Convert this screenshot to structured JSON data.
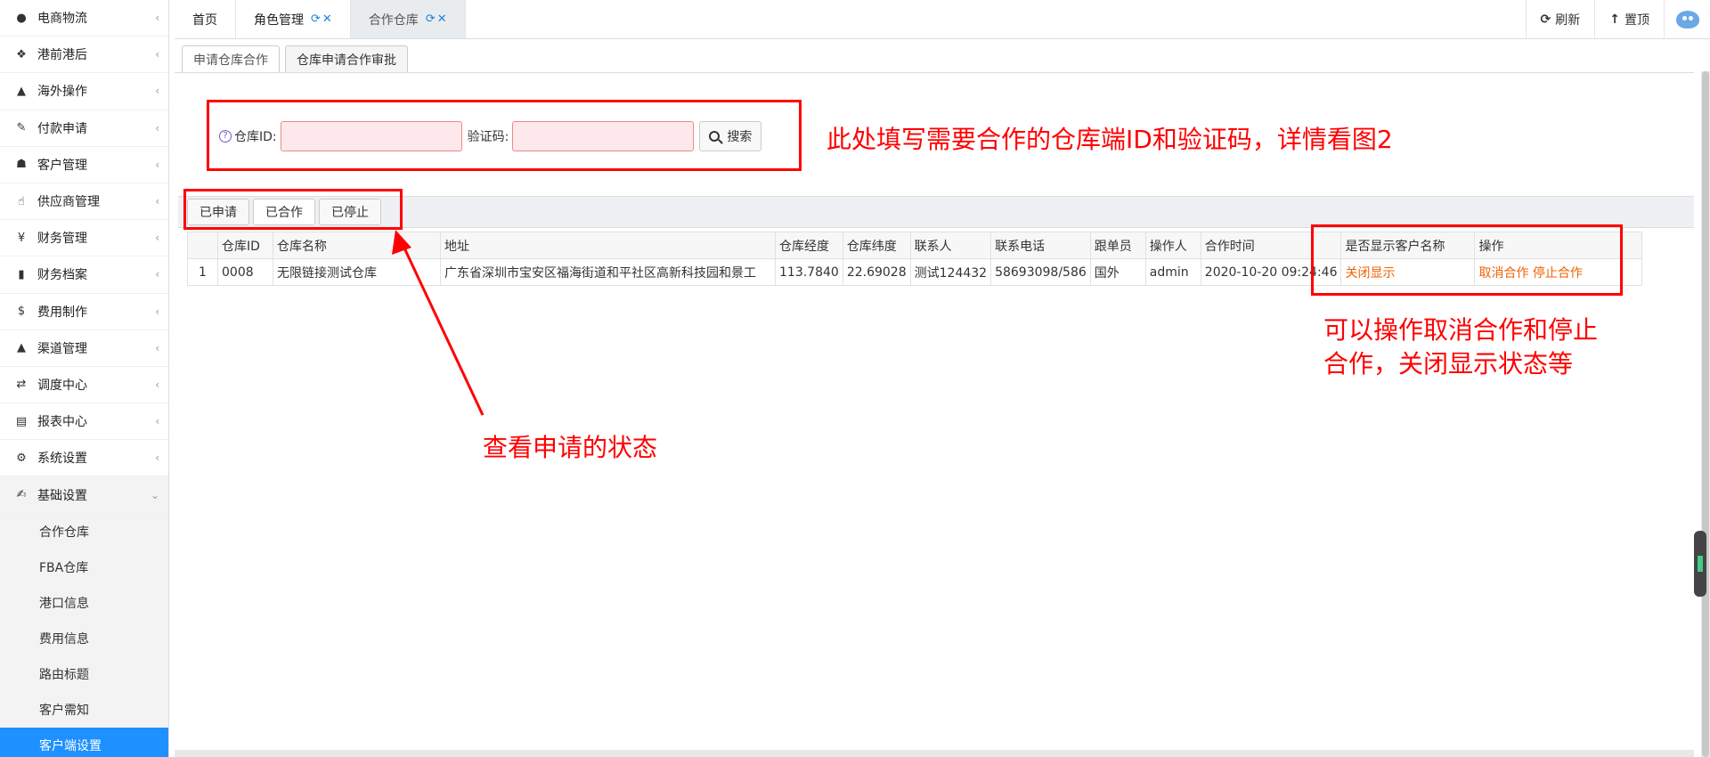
{
  "sidebar": {
    "items": [
      {
        "label": "电商物流",
        "icon": "globe-icon",
        "glyph": "●"
      },
      {
        "label": "港前港后",
        "icon": "cubes-icon",
        "glyph": "❖"
      },
      {
        "label": "海外操作",
        "icon": "ship-icon",
        "glyph": "▲"
      },
      {
        "label": "付款申请",
        "icon": "payment-icon",
        "glyph": "✎"
      },
      {
        "label": "客户管理",
        "icon": "users-icon",
        "glyph": "☗"
      },
      {
        "label": "供应商管理",
        "icon": "thumbs-up-icon",
        "glyph": "☝"
      },
      {
        "label": "财务管理",
        "icon": "yen-icon",
        "glyph": "¥"
      },
      {
        "label": "财务档案",
        "icon": "book-icon",
        "glyph": "▮"
      },
      {
        "label": "费用制作",
        "icon": "dollar-icon",
        "glyph": "$"
      },
      {
        "label": "渠道管理",
        "icon": "road-icon",
        "glyph": "▲"
      },
      {
        "label": "调度中心",
        "icon": "retweet-icon",
        "glyph": "⇄"
      },
      {
        "label": "报表中心",
        "icon": "file-icon",
        "glyph": "▤"
      },
      {
        "label": "系统设置",
        "icon": "gear-icon",
        "glyph": "⚙"
      },
      {
        "label": "基础设置",
        "icon": "edit-icon",
        "glyph": "✍"
      }
    ],
    "subitems": [
      {
        "label": "合作仓库"
      },
      {
        "label": "FBA仓库"
      },
      {
        "label": "港口信息"
      },
      {
        "label": "费用信息"
      },
      {
        "label": "路由标题"
      },
      {
        "label": "客户需知"
      },
      {
        "label": "客户端设置"
      }
    ]
  },
  "topbar": {
    "tabs": [
      {
        "label": "首页"
      },
      {
        "label": "角色管理"
      },
      {
        "label": "合作仓库"
      }
    ],
    "refresh": "刷新",
    "top": "置顶"
  },
  "subtabs": [
    {
      "label": "申请仓库合作"
    },
    {
      "label": "仓库申请合作审批"
    }
  ],
  "search": {
    "warehouse_id_label": "仓库ID:",
    "code_label": "验证码:",
    "warehouse_id_value": "",
    "code_value": "",
    "button": "搜索"
  },
  "status_buttons": [
    {
      "label": "已申请"
    },
    {
      "label": "已合作"
    },
    {
      "label": "已停止"
    }
  ],
  "table": {
    "columns": [
      "",
      "仓库ID",
      "仓库名称",
      "地址",
      "仓库经度",
      "仓库纬度",
      "联系人",
      "联系电话",
      "跟单员",
      "操作人",
      "合作时间",
      "是否显示客户名称",
      "操作"
    ],
    "rows": [
      {
        "index": "1",
        "id": "0008",
        "name": "无限链接测试仓库",
        "address": "广东省深圳市宝安区福海街道和平社区高新科技园和景工",
        "lng": "113.7840",
        "lat": "22.69028",
        "contact": "测试124432",
        "phone": "58693098/586",
        "merchandiser": "国外",
        "operator": "admin",
        "time": "2020-10-20 09:24:46",
        "show_name": "关闭显示",
        "cancel": "取消合作",
        "stop": "停止合作"
      }
    ]
  },
  "annotations": {
    "search_note": "此处填写需要合作的仓库端ID和验证码，详情看图2",
    "status_note": "查看申请的状态",
    "ops_note_line1": "可以操作取消合作和停止",
    "ops_note_line2": "合作，关闭显示状态等"
  },
  "colors": {
    "accent": "#1e90ff",
    "annotation": "#ff0000",
    "link": "#f06000"
  }
}
